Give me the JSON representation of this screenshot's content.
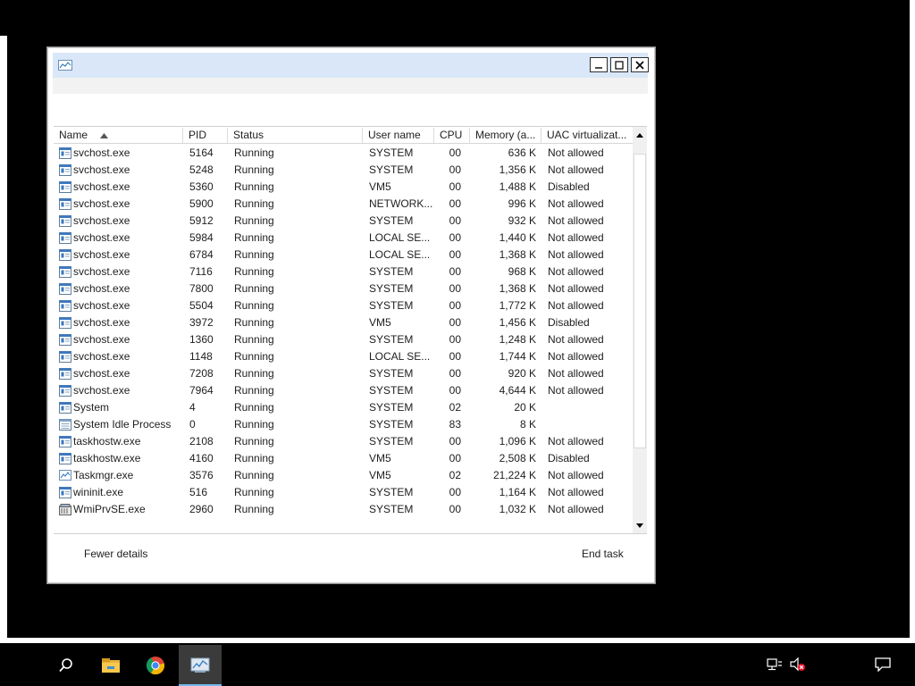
{
  "window": {
    "controls": {
      "minimize": "−",
      "maximize": "□",
      "close": "✕"
    }
  },
  "table": {
    "columns": [
      "Name",
      "PID",
      "Status",
      "User name",
      "CPU",
      "Memory (a...",
      "UAC virtualizat..."
    ],
    "sort_column": "Name",
    "sort_direction": "ascending",
    "rows": [
      {
        "name": "svchost.exe",
        "pid": "5164",
        "status": "Running",
        "user": "SYSTEM",
        "cpu": "00",
        "memory": "636 K",
        "uac": "Not allowed",
        "icon": "service-icon"
      },
      {
        "name": "svchost.exe",
        "pid": "5248",
        "status": "Running",
        "user": "SYSTEM",
        "cpu": "00",
        "memory": "1,356 K",
        "uac": "Not allowed",
        "icon": "service-icon"
      },
      {
        "name": "svchost.exe",
        "pid": "5360",
        "status": "Running",
        "user": "VM5",
        "cpu": "00",
        "memory": "1,488 K",
        "uac": "Disabled",
        "icon": "service-icon"
      },
      {
        "name": "svchost.exe",
        "pid": "5900",
        "status": "Running",
        "user": "NETWORK...",
        "cpu": "00",
        "memory": "996 K",
        "uac": "Not allowed",
        "icon": "service-icon"
      },
      {
        "name": "svchost.exe",
        "pid": "5912",
        "status": "Running",
        "user": "SYSTEM",
        "cpu": "00",
        "memory": "932 K",
        "uac": "Not allowed",
        "icon": "service-icon"
      },
      {
        "name": "svchost.exe",
        "pid": "5984",
        "status": "Running",
        "user": "LOCAL SE...",
        "cpu": "00",
        "memory": "1,440 K",
        "uac": "Not allowed",
        "icon": "service-icon"
      },
      {
        "name": "svchost.exe",
        "pid": "6784",
        "status": "Running",
        "user": "LOCAL SE...",
        "cpu": "00",
        "memory": "1,368 K",
        "uac": "Not allowed",
        "icon": "service-icon"
      },
      {
        "name": "svchost.exe",
        "pid": "7116",
        "status": "Running",
        "user": "SYSTEM",
        "cpu": "00",
        "memory": "968 K",
        "uac": "Not allowed",
        "icon": "service-icon"
      },
      {
        "name": "svchost.exe",
        "pid": "7800",
        "status": "Running",
        "user": "SYSTEM",
        "cpu": "00",
        "memory": "1,368 K",
        "uac": "Not allowed",
        "icon": "service-icon"
      },
      {
        "name": "svchost.exe",
        "pid": "5504",
        "status": "Running",
        "user": "SYSTEM",
        "cpu": "00",
        "memory": "1,772 K",
        "uac": "Not allowed",
        "icon": "service-icon"
      },
      {
        "name": "svchost.exe",
        "pid": "3972",
        "status": "Running",
        "user": "VM5",
        "cpu": "00",
        "memory": "1,456 K",
        "uac": "Disabled",
        "icon": "service-icon"
      },
      {
        "name": "svchost.exe",
        "pid": "1360",
        "status": "Running",
        "user": "SYSTEM",
        "cpu": "00",
        "memory": "1,248 K",
        "uac": "Not allowed",
        "icon": "service-icon"
      },
      {
        "name": "svchost.exe",
        "pid": "1148",
        "status": "Running",
        "user": "LOCAL SE...",
        "cpu": "00",
        "memory": "1,744 K",
        "uac": "Not allowed",
        "icon": "service-icon"
      },
      {
        "name": "svchost.exe",
        "pid": "7208",
        "status": "Running",
        "user": "SYSTEM",
        "cpu": "00",
        "memory": "920 K",
        "uac": "Not allowed",
        "icon": "service-icon"
      },
      {
        "name": "svchost.exe",
        "pid": "7964",
        "status": "Running",
        "user": "SYSTEM",
        "cpu": "00",
        "memory": "4,644 K",
        "uac": "Not allowed",
        "icon": "service-icon"
      },
      {
        "name": "System",
        "pid": "4",
        "status": "Running",
        "user": "SYSTEM",
        "cpu": "02",
        "memory": "20 K",
        "uac": "",
        "icon": "service-icon"
      },
      {
        "name": "System Idle Process",
        "pid": "0",
        "status": "Running",
        "user": "SYSTEM",
        "cpu": "83",
        "memory": "8 K",
        "uac": "",
        "icon": "window-icon"
      },
      {
        "name": "taskhostw.exe",
        "pid": "2108",
        "status": "Running",
        "user": "SYSTEM",
        "cpu": "00",
        "memory": "1,096 K",
        "uac": "Not allowed",
        "icon": "service-icon"
      },
      {
        "name": "taskhostw.exe",
        "pid": "4160",
        "status": "Running",
        "user": "VM5",
        "cpu": "00",
        "memory": "2,508 K",
        "uac": "Disabled",
        "icon": "service-icon"
      },
      {
        "name": "Taskmgr.exe",
        "pid": "3576",
        "status": "Running",
        "user": "VM5",
        "cpu": "02",
        "memory": "21,224 K",
        "uac": "Not allowed",
        "icon": "taskmgr-icon"
      },
      {
        "name": "wininit.exe",
        "pid": "516",
        "status": "Running",
        "user": "SYSTEM",
        "cpu": "00",
        "memory": "1,164 K",
        "uac": "Not allowed",
        "icon": "service-icon"
      },
      {
        "name": "WmiPrvSE.exe",
        "pid": "2960",
        "status": "Running",
        "user": "SYSTEM",
        "cpu": "00",
        "memory": "1,032 K",
        "uac": "Not allowed",
        "icon": "wmi-icon"
      }
    ]
  },
  "footer": {
    "fewer_details": "Fewer details",
    "end_task": "End task"
  },
  "taskbar": {
    "apps": [
      "search-icon",
      "file-explorer-icon",
      "chrome-icon",
      "task-manager-icon"
    ],
    "active_app": "task-manager-icon"
  },
  "colors": {
    "titlebar": "#d9e7f8",
    "taskbar": "#000000",
    "active_accent": "#76b9ed"
  }
}
